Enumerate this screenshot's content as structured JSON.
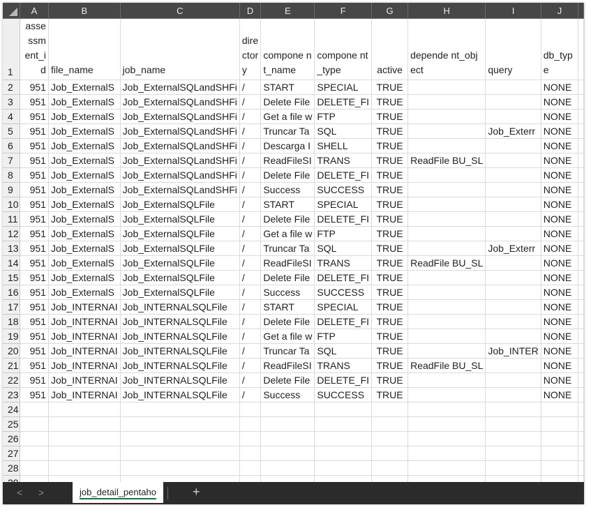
{
  "columns": [
    "A",
    "B",
    "C",
    "D",
    "E",
    "F",
    "G",
    "H",
    "I",
    "J"
  ],
  "header_row": {
    "row_number": "1",
    "cells": [
      "assessm ent_id",
      "file_name",
      "job_name",
      "directory",
      "compone nt_name",
      "compone nt_type",
      "active",
      "depende nt_object",
      "query",
      "db_type"
    ]
  },
  "rows": [
    {
      "n": "2",
      "cells": [
        "951",
        "Job_ExternalS",
        "Job_ExternalSQLandSHFi",
        "/",
        "START",
        "SPECIAL",
        "TRUE",
        "",
        "",
        "NONE"
      ]
    },
    {
      "n": "3",
      "cells": [
        "951",
        "Job_ExternalS",
        "Job_ExternalSQLandSHFi",
        "/",
        "Delete File",
        "DELETE_FI",
        "TRUE",
        "",
        "",
        "NONE"
      ]
    },
    {
      "n": "4",
      "cells": [
        "951",
        "Job_ExternalS",
        "Job_ExternalSQLandSHFi",
        "/",
        "Get a file w",
        "FTP",
        "TRUE",
        "",
        "",
        "NONE"
      ]
    },
    {
      "n": "5",
      "cells": [
        "951",
        "Job_ExternalS",
        "Job_ExternalSQLandSHFi",
        "/",
        "Truncar Ta",
        "SQL",
        "TRUE",
        "",
        "Job_Exterr",
        "NONE"
      ]
    },
    {
      "n": "6",
      "cells": [
        "951",
        "Job_ExternalS",
        "Job_ExternalSQLandSHFi",
        "/",
        "Descarga I",
        "SHELL",
        "TRUE",
        "",
        "",
        "NONE"
      ]
    },
    {
      "n": "7",
      "cells": [
        "951",
        "Job_ExternalS",
        "Job_ExternalSQLandSHFi",
        "/",
        "ReadFileSI",
        "TRANS",
        "TRUE",
        "ReadFile BU_SL",
        "",
        "NONE"
      ]
    },
    {
      "n": "8",
      "cells": [
        "951",
        "Job_ExternalS",
        "Job_ExternalSQLandSHFi",
        "/",
        "Delete File",
        "DELETE_FI",
        "TRUE",
        "",
        "",
        "NONE"
      ]
    },
    {
      "n": "9",
      "cells": [
        "951",
        "Job_ExternalS",
        "Job_ExternalSQLandSHFi",
        "/",
        "Success",
        "SUCCESS",
        "TRUE",
        "",
        "",
        "NONE"
      ]
    },
    {
      "n": "10",
      "cells": [
        "951",
        "Job_ExternalS",
        "Job_ExternalSQLFile",
        "/",
        "START",
        "SPECIAL",
        "TRUE",
        "",
        "",
        "NONE"
      ]
    },
    {
      "n": "11",
      "cells": [
        "951",
        "Job_ExternalS",
        "Job_ExternalSQLFile",
        "/",
        "Delete File",
        "DELETE_FI",
        "TRUE",
        "",
        "",
        "NONE"
      ]
    },
    {
      "n": "12",
      "cells": [
        "951",
        "Job_ExternalS",
        "Job_ExternalSQLFile",
        "/",
        "Get a file w",
        "FTP",
        "TRUE",
        "",
        "",
        "NONE"
      ]
    },
    {
      "n": "13",
      "cells": [
        "951",
        "Job_ExternalS",
        "Job_ExternalSQLFile",
        "/",
        "Truncar Ta",
        "SQL",
        "TRUE",
        "",
        "Job_Exterr",
        "NONE"
      ]
    },
    {
      "n": "14",
      "cells": [
        "951",
        "Job_ExternalS",
        "Job_ExternalSQLFile",
        "/",
        "ReadFileSI",
        "TRANS",
        "TRUE",
        "ReadFile BU_SL",
        "",
        "NONE"
      ]
    },
    {
      "n": "15",
      "cells": [
        "951",
        "Job_ExternalS",
        "Job_ExternalSQLFile",
        "/",
        "Delete File",
        "DELETE_FI",
        "TRUE",
        "",
        "",
        "NONE"
      ]
    },
    {
      "n": "16",
      "cells": [
        "951",
        "Job_ExternalS",
        "Job_ExternalSQLFile",
        "/",
        "Success",
        "SUCCESS",
        "TRUE",
        "",
        "",
        "NONE"
      ]
    },
    {
      "n": "17",
      "cells": [
        "951",
        "Job_INTERNAI",
        "Job_INTERNALSQLFile",
        "/",
        "START",
        "SPECIAL",
        "TRUE",
        "",
        "",
        "NONE"
      ]
    },
    {
      "n": "18",
      "cells": [
        "951",
        "Job_INTERNAI",
        "Job_INTERNALSQLFile",
        "/",
        "Delete File",
        "DELETE_FI",
        "TRUE",
        "",
        "",
        "NONE"
      ]
    },
    {
      "n": "19",
      "cells": [
        "951",
        "Job_INTERNAI",
        "Job_INTERNALSQLFile",
        "/",
        "Get a file w",
        "FTP",
        "TRUE",
        "",
        "",
        "NONE"
      ]
    },
    {
      "n": "20",
      "cells": [
        "951",
        "Job_INTERNAI",
        "Job_INTERNALSQLFile",
        "/",
        "Truncar Ta",
        "SQL",
        "TRUE",
        "",
        "Job_INTER",
        "NONE"
      ]
    },
    {
      "n": "21",
      "cells": [
        "951",
        "Job_INTERNAI",
        "Job_INTERNALSQLFile",
        "/",
        "ReadFileSI",
        "TRANS",
        "TRUE",
        "ReadFile BU_SL",
        "",
        "NONE"
      ]
    },
    {
      "n": "22",
      "cells": [
        "951",
        "Job_INTERNAI",
        "Job_INTERNALSQLFile",
        "/",
        "Delete File",
        "DELETE_FI",
        "TRUE",
        "",
        "",
        "NONE"
      ]
    },
    {
      "n": "23",
      "cells": [
        "951",
        "Job_INTERNAI",
        "Job_INTERNALSQLFile",
        "/",
        "Success",
        "SUCCESS",
        "TRUE",
        "",
        "",
        "NONE"
      ]
    },
    {
      "n": "24",
      "cells": [
        "",
        "",
        "",
        "",
        "",
        "",
        "",
        "",
        "",
        ""
      ]
    },
    {
      "n": "25",
      "cells": [
        "",
        "",
        "",
        "",
        "",
        "",
        "",
        "",
        "",
        ""
      ]
    },
    {
      "n": "26",
      "cells": [
        "",
        "",
        "",
        "",
        "",
        "",
        "",
        "",
        "",
        ""
      ]
    },
    {
      "n": "27",
      "cells": [
        "",
        "",
        "",
        "",
        "",
        "",
        "",
        "",
        "",
        ""
      ]
    },
    {
      "n": "28",
      "cells": [
        "",
        "",
        "",
        "",
        "",
        "",
        "",
        "",
        "",
        ""
      ]
    },
    {
      "n": "29",
      "cells": [
        "",
        "",
        "",
        "",
        "",
        "",
        "",
        "",
        "",
        ""
      ]
    }
  ],
  "sheet_tab": {
    "label": "job_detail_pentaho",
    "accent": "#1e7145"
  },
  "nav": {
    "prev_icon": "chevron-left-icon",
    "next_icon": "chevron-right-icon",
    "prev_glyph": "<",
    "next_glyph": ">",
    "add_glyph": "+"
  }
}
